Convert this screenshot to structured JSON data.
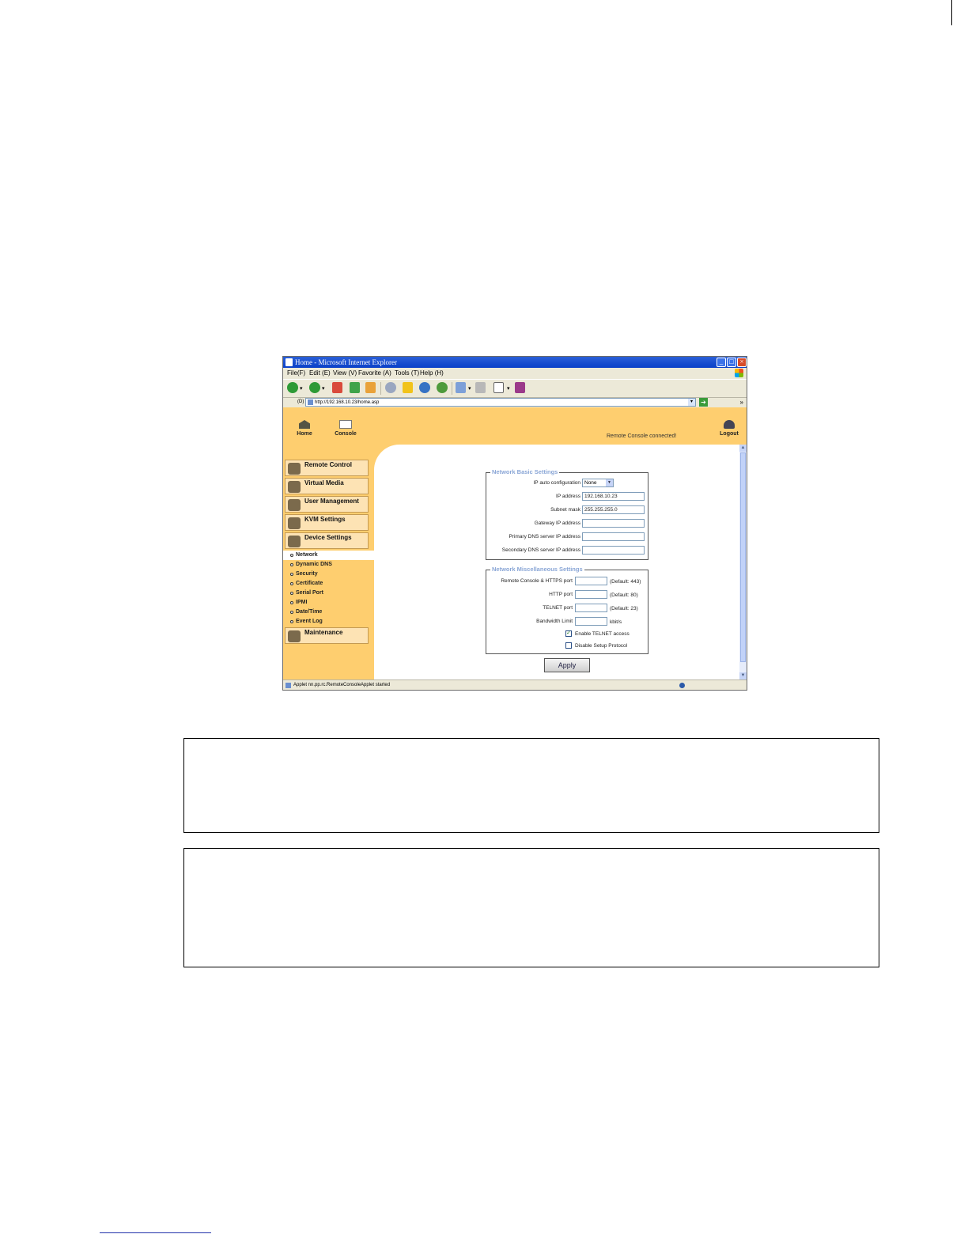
{
  "window": {
    "title": "Home - Microsoft Internet Explorer",
    "minimize": "_",
    "maximize": "□",
    "close": "×"
  },
  "menu": {
    "file": "File",
    "file_key": "(F)",
    "edit": "Edit",
    "edit_key": "(E)",
    "view": "View",
    "view_key": "(V)",
    "favorite": "Favorite",
    "favorite_key": "(A)",
    "tools": "Tools",
    "tools_key": "(T)",
    "help": "Help",
    "help_key": "(H)"
  },
  "address": {
    "label": "(D)",
    "url": "http://192.168.10.23/home.asp",
    "more": "»"
  },
  "header": {
    "home": "Home",
    "console": "Console",
    "status": "Remote Console connected!",
    "logout": "Logout"
  },
  "sidebar": {
    "items": [
      {
        "label": "Remote Control"
      },
      {
        "label": "Virtual Media"
      },
      {
        "label": "User Management"
      },
      {
        "label": "KVM Settings"
      },
      {
        "label": "Device Settings"
      }
    ],
    "subitems": [
      {
        "label": "Network"
      },
      {
        "label": "Dynamic DNS"
      },
      {
        "label": "Security"
      },
      {
        "label": "Certificate"
      },
      {
        "label": "Serial Port"
      },
      {
        "label": "IPMI"
      },
      {
        "label": "Date/Time"
      },
      {
        "label": "Event Log"
      }
    ],
    "maintenance": "Maintenance"
  },
  "basic": {
    "legend": "Network Basic Settings",
    "ip_auto_label": "IP auto configuration",
    "ip_auto_value": "None",
    "ip_label": "IP address",
    "ip_value": "192.168.10.23",
    "mask_label": "Subnet mask",
    "mask_value": "255.255.255.0",
    "gateway_label": "Gateway IP address",
    "gateway_value": "",
    "dns1_label": "Primary DNS server IP address",
    "dns1_value": "",
    "dns2_label": "Secondary DNS server IP address",
    "dns2_value": ""
  },
  "misc": {
    "legend": "Network Miscellaneous Settings",
    "https_label": "Remote Console & HTTPS port",
    "https_default": "(Default: 443)",
    "http_label": "HTTP port",
    "http_default": "(Default: 80)",
    "telnet_label": "TELNET port",
    "telnet_default": "(Default: 23)",
    "bw_label": "Bandwidth Limit",
    "bw_unit": "kbit/s",
    "enable_telnet": "Enable TELNET access",
    "enable_telnet_checked": true,
    "disable_setup": "Disable Setup Protocol",
    "disable_setup_checked": false
  },
  "apply": "Apply",
  "status_bar": "Applet nn.pp.rc.RemoteConsoleApplet started"
}
